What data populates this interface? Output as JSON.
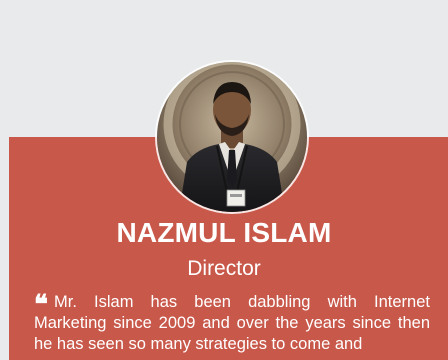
{
  "profile": {
    "name": "NAZMUL ISLAM",
    "title": "Director",
    "quote_icon": "❝",
    "quote": "Mr. Islam has been dabbling with Internet Marketing since 2009 and over the years since then he has seen so many strategies to come and"
  },
  "colors": {
    "background": "#e9eaec",
    "card": "#c8584a",
    "text": "#ffffff"
  },
  "icons": {
    "quote": "quote-left-icon"
  }
}
